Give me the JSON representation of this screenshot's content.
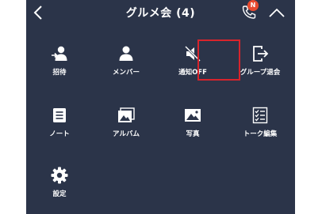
{
  "header": {
    "title": "グルメ会 (4)",
    "call_badge": "N",
    "back_icon": "chevron-left-icon",
    "call_icon": "phone-icon",
    "collapse_icon": "chevron-up-icon"
  },
  "menu": {
    "items": [
      {
        "label": "招待",
        "icon": "add-person-icon"
      },
      {
        "label": "メンバー",
        "icon": "person-icon"
      },
      {
        "label": "通知OFF",
        "icon": "speaker-mute-icon"
      },
      {
        "label": "グループ退会",
        "icon": "exit-icon"
      },
      {
        "label": "ノート",
        "icon": "note-icon"
      },
      {
        "label": "アルバム",
        "icon": "album-icon"
      },
      {
        "label": "写真",
        "icon": "photo-icon"
      },
      {
        "label": "トーク編集",
        "icon": "edit-list-icon"
      },
      {
        "label": "設定",
        "icon": "gear-icon"
      }
    ]
  },
  "colors": {
    "panel_bg": "#2b3449",
    "highlight_border": "#d8242c",
    "badge_bg": "#e84a2f"
  }
}
